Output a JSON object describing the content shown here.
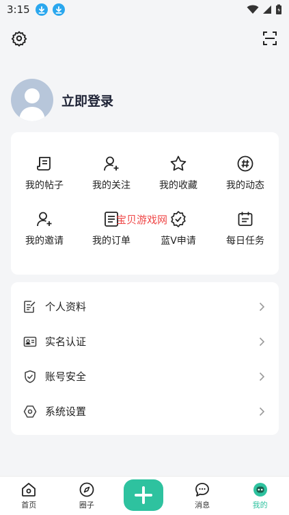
{
  "status_bar": {
    "time": "3:15"
  },
  "header": {
    "settings_icon": "gear-icon",
    "scan_icon": "scan-icon"
  },
  "profile": {
    "login_label": "立即登录"
  },
  "watermark": "宝贝游戏网",
  "grid_items": [
    {
      "label": "我的帖子",
      "icon": "post-icon"
    },
    {
      "label": "我的关注",
      "icon": "follow-icon"
    },
    {
      "label": "我的收藏",
      "icon": "star-icon"
    },
    {
      "label": "我的动态",
      "icon": "hashtag-icon"
    },
    {
      "label": "我的邀请",
      "icon": "invite-icon"
    },
    {
      "label": "我的订单",
      "icon": "order-icon"
    },
    {
      "label": "蓝V申请",
      "icon": "verified-icon"
    },
    {
      "label": "每日任务",
      "icon": "calendar-icon"
    }
  ],
  "list_items": [
    {
      "label": "个人资料",
      "icon": "profile-doc-icon"
    },
    {
      "label": "实名认证",
      "icon": "id-card-icon"
    },
    {
      "label": "账号安全",
      "icon": "shield-icon"
    },
    {
      "label": "系统设置",
      "icon": "hexagon-settings-icon"
    }
  ],
  "tabs": [
    {
      "label": "首页",
      "icon": "home-icon"
    },
    {
      "label": "圈子",
      "icon": "compass-icon"
    },
    {
      "label": "",
      "icon": "plus-icon"
    },
    {
      "label": "消息",
      "icon": "message-icon"
    },
    {
      "label": "我的",
      "icon": "me-icon"
    }
  ],
  "colors": {
    "accent": "#2ec29f",
    "download_badge": "#2aa7ee",
    "background": "#f4f5f7"
  }
}
